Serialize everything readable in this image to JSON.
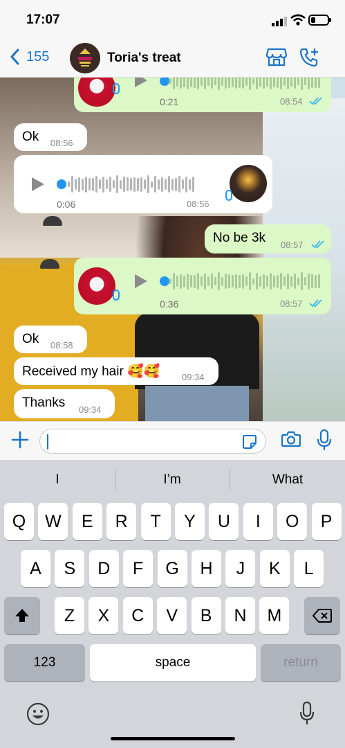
{
  "status_bar": {
    "time": "17:07",
    "battery_level": 0.25
  },
  "header": {
    "back_count": "155",
    "chat_name": "Toria's treat",
    "icons": [
      "back-chevron-icon",
      "store-icon",
      "add-call-icon"
    ]
  },
  "messages": [
    {
      "kind": "voice",
      "direction": "out",
      "duration": "0:21",
      "time": "08:54",
      "read": true
    },
    {
      "kind": "text",
      "direction": "in",
      "text": "Ok",
      "time": "08:56"
    },
    {
      "kind": "voice",
      "direction": "in",
      "duration": "0:06",
      "time": "08:56"
    },
    {
      "kind": "text",
      "direction": "out",
      "text": "No be 3k",
      "time": "08:57",
      "read": true
    },
    {
      "kind": "voice",
      "direction": "out",
      "duration": "0:36",
      "time": "08:57",
      "read": true
    },
    {
      "kind": "text",
      "direction": "in",
      "text": "Ok",
      "time": "08:58"
    },
    {
      "kind": "text",
      "direction": "in",
      "text": "Received my hair 🥰🥰",
      "time": "09:34"
    },
    {
      "kind": "text",
      "direction": "in",
      "text": "Thanks",
      "time": "09:34"
    }
  ],
  "input": {
    "value": "",
    "icons": [
      "plus-icon",
      "sticker-icon",
      "camera-icon",
      "mic-icon"
    ]
  },
  "keyboard": {
    "suggestions": [
      "I",
      "I’m",
      "What"
    ],
    "row1": [
      "Q",
      "W",
      "E",
      "R",
      "T",
      "Y",
      "U",
      "I",
      "O",
      "P"
    ],
    "row2": [
      "A",
      "S",
      "D",
      "F",
      "G",
      "H",
      "J",
      "K",
      "L"
    ],
    "row3": [
      "Z",
      "X",
      "C",
      "V",
      "B",
      "N",
      "M"
    ],
    "numbers_label": "123",
    "space_label": "space",
    "return_label": "return",
    "icons": [
      "shift-icon",
      "backspace-icon",
      "emoji-icon",
      "dictation-icon"
    ]
  },
  "colors": {
    "accent": "#1a73c9",
    "outgoing_bubble": "#dcf8c6",
    "incoming_bubble": "#ffffff",
    "read_check": "#34b7f1"
  }
}
